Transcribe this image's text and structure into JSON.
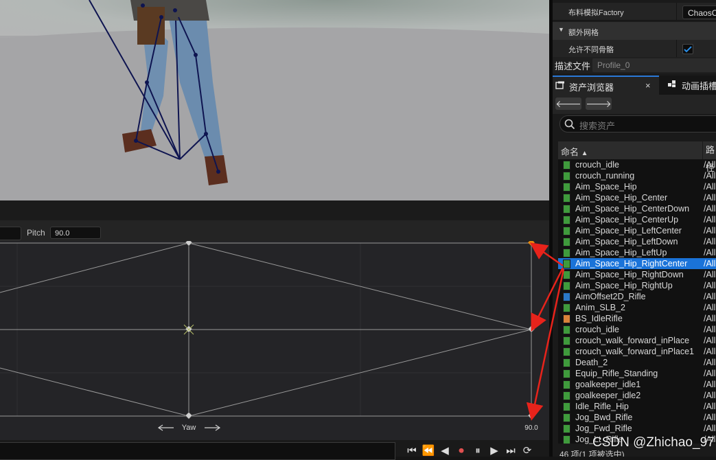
{
  "details": {
    "cloth_factory": {
      "label": "布料模拟Factory",
      "value": "ChaosC"
    },
    "extra_mesh_section": "额外网格",
    "allow_diff_skeleton": {
      "label": "允许不同骨骼",
      "checked": true
    },
    "descriptor": {
      "label": "描述文件",
      "value": "Profile_0"
    }
  },
  "tabs": {
    "asset_browser": "资产浏览器",
    "close": "×",
    "anim_slot": "动画插槽"
  },
  "nav": {
    "back": "🡐",
    "forward": "🡒"
  },
  "search": {
    "placeholder": "搜索资产"
  },
  "list": {
    "col_name": "命名",
    "col_path": "路径",
    "rows": [
      {
        "name": "crouch_idle",
        "path": "/All",
        "icon": "anim-sequence-icon"
      },
      {
        "name": "crouch_running",
        "path": "/All",
        "icon": "anim-sequence-icon"
      },
      {
        "name": "Aim_Space_Hip",
        "path": "/All",
        "icon": "anim-sequence-icon"
      },
      {
        "name": "Aim_Space_Hip_Center",
        "path": "/All",
        "icon": "anim-sequence-icon"
      },
      {
        "name": "Aim_Space_Hip_CenterDown",
        "path": "/All",
        "icon": "anim-sequence-icon"
      },
      {
        "name": "Aim_Space_Hip_CenterUp",
        "path": "/All",
        "icon": "anim-sequence-icon"
      },
      {
        "name": "Aim_Space_Hip_LeftCenter",
        "path": "/All",
        "icon": "anim-sequence-icon"
      },
      {
        "name": "Aim_Space_Hip_LeftDown",
        "path": "/All",
        "icon": "anim-sequence-icon"
      },
      {
        "name": "Aim_Space_Hip_LeftUp",
        "path": "/All",
        "icon": "anim-sequence-icon"
      },
      {
        "name": "Aim_Space_Hip_RightCenter",
        "path": "/All",
        "icon": "anim-sequence-icon",
        "selected": true
      },
      {
        "name": "Aim_Space_Hip_RightDown",
        "path": "/All",
        "icon": "anim-sequence-icon"
      },
      {
        "name": "Aim_Space_Hip_RightUp",
        "path": "/All",
        "icon": "anim-sequence-icon"
      },
      {
        "name": "AimOffset2D_Rifle",
        "path": "/All",
        "icon": "aim-offset-icon"
      },
      {
        "name": "Anim_SLB_2",
        "path": "/All",
        "icon": "anim-sequence-icon"
      },
      {
        "name": "BS_IdleRifle",
        "path": "/All",
        "icon": "blendspace-icon"
      },
      {
        "name": "crouch_idle",
        "path": "/All",
        "icon": "anim-sequence-icon"
      },
      {
        "name": "crouch_walk_forward_inPlace",
        "path": "/All",
        "icon": "anim-sequence-icon"
      },
      {
        "name": "crouch_walk_forward_inPlace1",
        "path": "/All",
        "icon": "anim-sequence-icon"
      },
      {
        "name": "Death_2",
        "path": "/All",
        "icon": "anim-sequence-icon"
      },
      {
        "name": "Equip_Rifle_Standing",
        "path": "/All",
        "icon": "anim-sequence-icon"
      },
      {
        "name": "goalkeeper_idle1",
        "path": "/All",
        "icon": "anim-sequence-icon"
      },
      {
        "name": "goalkeeper_idle2",
        "path": "/All",
        "icon": "anim-sequence-icon"
      },
      {
        "name": "Idle_Rifle_Hip",
        "path": "/All",
        "icon": "anim-sequence-icon"
      },
      {
        "name": "Jog_Bwd_Rifle",
        "path": "/All",
        "icon": "anim-sequence-icon"
      },
      {
        "name": "Jog_Fwd_Rifle",
        "path": "/All",
        "icon": "anim-sequence-icon"
      },
      {
        "name": "Jog_Lt_Rifle",
        "path": "/All",
        "icon": "anim-sequence-icon"
      }
    ]
  },
  "status": "46 项(1 项被选中)",
  "blendspace": {
    "pitch_label": "Pitch",
    "pitch_value": "90.0",
    "axis_label": "Yaw",
    "axis_max": "90.0"
  },
  "transport": [
    "⏮",
    "⏪",
    "◀",
    "⏺",
    "⏸",
    "▶",
    "⏭",
    "⟳"
  ],
  "watermark": "CSDN @Zhichao_97",
  "colors": {
    "selection": "#1a73d9",
    "accent": "#2a79d8",
    "annotation_arrow": "#e8231b",
    "sample_highlight": "#e88a0c"
  }
}
